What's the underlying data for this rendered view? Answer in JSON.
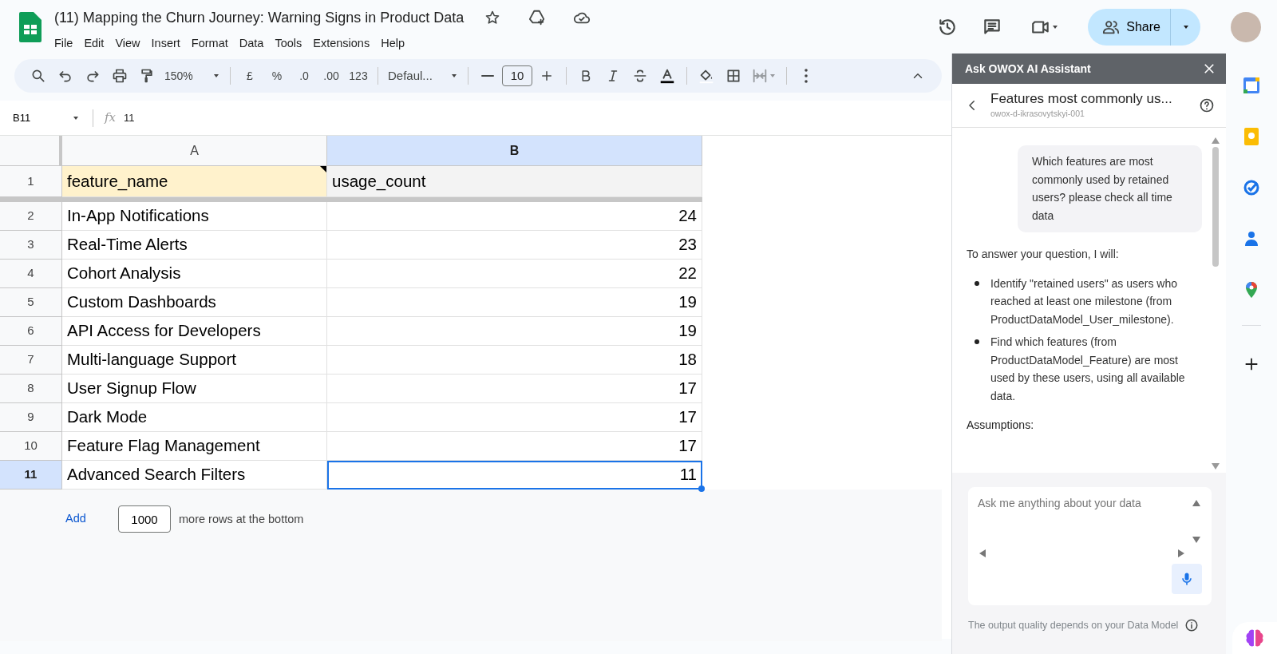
{
  "document": {
    "title": "(11) Mapping the Churn Journey: Warning Signs in Product Data",
    "menu": [
      "File",
      "Edit",
      "View",
      "Insert",
      "Format",
      "Data",
      "Tools",
      "Extensions",
      "Help"
    ]
  },
  "share": {
    "label": "Share"
  },
  "toolbar": {
    "zoom": "150%",
    "currency": "£",
    "percent": "%",
    "decrease_decimals": ".0",
    "increase_decimals": ".00",
    "number_format": "123",
    "font": "Defaul...",
    "font_size": "10"
  },
  "formula_bar": {
    "cell_ref": "B11",
    "fx": "fx",
    "value": "11"
  },
  "grid": {
    "columns": [
      {
        "label": "A",
        "selected": false,
        "kind": "text"
      },
      {
        "label": "B",
        "selected": true,
        "kind": "number"
      }
    ],
    "header_row": {
      "number": "1",
      "cells": [
        "feature_name",
        "usage_count"
      ]
    },
    "rows": [
      {
        "number": "2",
        "cells": [
          "In-App Notifications",
          "24"
        ],
        "selected": false
      },
      {
        "number": "3",
        "cells": [
          "Real-Time Alerts",
          "23"
        ],
        "selected": false
      },
      {
        "number": "4",
        "cells": [
          "Cohort Analysis",
          "22"
        ],
        "selected": false
      },
      {
        "number": "5",
        "cells": [
          "Custom Dashboards",
          "19"
        ],
        "selected": false
      },
      {
        "number": "6",
        "cells": [
          "API Access for Developers",
          "19"
        ],
        "selected": false
      },
      {
        "number": "7",
        "cells": [
          "Multi-language Support",
          "18"
        ],
        "selected": false
      },
      {
        "number": "8",
        "cells": [
          "User Signup Flow",
          "17"
        ],
        "selected": false
      },
      {
        "number": "9",
        "cells": [
          "Dark Mode",
          "17"
        ],
        "selected": false
      },
      {
        "number": "10",
        "cells": [
          "Feature Flag Management",
          "17"
        ],
        "selected": false
      },
      {
        "number": "11",
        "cells": [
          "Advanced Search Filters",
          "11"
        ],
        "selected": true
      }
    ]
  },
  "add_rows": {
    "button": "Add",
    "count": "1000",
    "text": "more rows at the bottom"
  },
  "assistant": {
    "title": "Ask OWOX AI Assistant",
    "chat_title": "Features most commonly us...",
    "chat_subtitle": "owox-d-ikrasovytskyi-001",
    "messages": [
      {
        "kind": "user",
        "text": "Which features are most commonly used by retained users? please check all time data"
      },
      {
        "kind": "assistant",
        "intro": "To answer your question, I will:",
        "bullets": [
          "Identify \"retained users\" as users who reached at least one milestone (from ProductDataModel_User_milestone).",
          "Find which features (from ProductDataModel_Feature) are most used by these users, using all available data."
        ],
        "heading": "Assumptions:"
      }
    ],
    "input": {
      "placeholder": "Ask me anything about your data"
    },
    "footer": "The output quality depends on your Data Model"
  }
}
